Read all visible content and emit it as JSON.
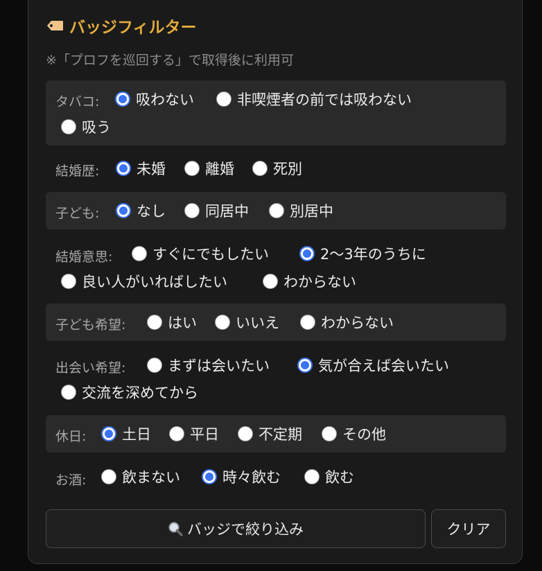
{
  "header": {
    "title": "バッジフィルター",
    "icon": "tag-icon",
    "note": "※「プロフを巡回する」で取得後に利用可"
  },
  "filters": {
    "tobacco": {
      "label": "タバコ:",
      "options": [
        "吸わない",
        "非喫煙者の前では吸わない",
        "吸う"
      ],
      "selected": "吸わない"
    },
    "marriage_history": {
      "label": "結婚歴:",
      "options": [
        "未婚",
        "離婚",
        "死別"
      ],
      "selected": "未婚"
    },
    "children": {
      "label": "子ども:",
      "options": [
        "なし",
        "同居中",
        "別居中"
      ],
      "selected": "なし"
    },
    "marriage_intent": {
      "label": "結婚意思:",
      "options": [
        "すぐにでもしたい",
        "2〜3年のうちに",
        "良い人がいればしたい",
        "わからない"
      ],
      "selected": "2〜3年のうちに"
    },
    "children_wish": {
      "label": "子ども希望:",
      "options": [
        "はい",
        "いいえ",
        "わからない"
      ],
      "selected": null
    },
    "meeting_wish": {
      "label": "出会い希望:",
      "options": [
        "まずは会いたい",
        "気が合えば会いたい",
        "交流を深めてから"
      ],
      "selected": "気が合えば会いたい"
    },
    "holiday": {
      "label": "休日:",
      "options": [
        "土日",
        "平日",
        "不定期",
        "その他"
      ],
      "selected": "土日"
    },
    "alcohol": {
      "label": "お酒:",
      "options": [
        "飲まない",
        "時々飲む",
        "飲む"
      ],
      "selected": "時々飲む"
    }
  },
  "buttons": {
    "filter_label": "バッジで絞り込み",
    "filter_icon": "magnifier-icon",
    "clear_label": "クリア"
  },
  "colors": {
    "accent": "#e3ac3c",
    "radio_selected": "#3b73f5",
    "panel_bg": "#1a1a1a",
    "row_bg": "#2a2a2a"
  }
}
